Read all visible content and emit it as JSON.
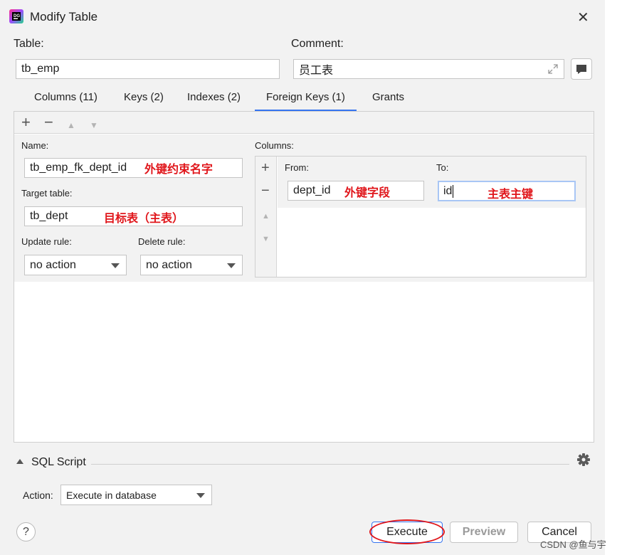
{
  "window": {
    "title": "Modify Table",
    "close_glyph": "✕"
  },
  "table": {
    "label": "Table:",
    "value": "tb_emp"
  },
  "comment": {
    "label": "Comment:",
    "value": "员工表"
  },
  "tabs": [
    {
      "label": "Columns (11)"
    },
    {
      "label": "Keys (2)"
    },
    {
      "label": "Indexes (2)"
    },
    {
      "label": "Foreign Keys (1)",
      "active": true
    },
    {
      "label": "Grants"
    }
  ],
  "toolbar": {
    "add": "+",
    "remove": "−",
    "up": "▲",
    "down": "▼"
  },
  "fk": {
    "name_label": "Name:",
    "name_value": "tb_emp_fk_dept_id",
    "name_note": "外键约束名字",
    "target_label": "Target table:",
    "target_value": "tb_dept",
    "target_note": "目标表（主表）",
    "update_label": "Update rule:",
    "update_value": "no action",
    "delete_label": "Delete rule:",
    "delete_value": "no action"
  },
  "columns": {
    "label": "Columns:",
    "from_header": "From:",
    "to_header": "To:",
    "from_value": "dept_id",
    "from_note": "外键字段",
    "to_value": "id",
    "to_note": "主表主键"
  },
  "sql": {
    "label": "SQL Script",
    "action_label": "Action:",
    "action_value": "Execute in database"
  },
  "buttons": {
    "help": "?",
    "execute": "Execute",
    "preview": "Preview",
    "cancel": "Cancel"
  },
  "watermark": "CSDN @鱼与宇",
  "colors": {
    "accent": "#3574f0",
    "annotation": "#e0161b"
  }
}
